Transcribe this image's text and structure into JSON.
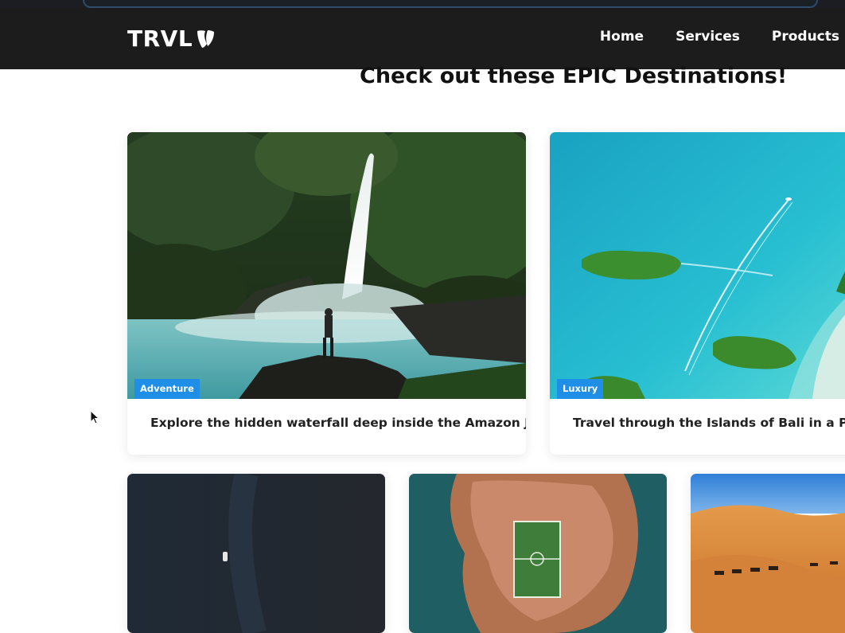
{
  "header": {
    "logo_text": "TRVL",
    "logo_icon": "typo3-icon",
    "nav": [
      {
        "label": "Home"
      },
      {
        "label": "Services"
      },
      {
        "label": "Products"
      }
    ]
  },
  "main": {
    "heading": "Check out these EPIC Destinations!",
    "cards": [
      {
        "image": "waterfall-jungle-photo",
        "badge": "Adventure",
        "title": "Explore the hidden waterfall deep inside the Amazon Jungle"
      },
      {
        "image": "bali-islands-aerial-photo",
        "badge": "Luxury",
        "title": "Travel through the Islands of Bali in a Private C"
      },
      {
        "image": "ocean-boat-aerial-photo"
      },
      {
        "image": "island-football-field-photo"
      },
      {
        "image": "desert-camels-photo"
      }
    ]
  },
  "colors": {
    "navbar_bg": "#1c1c1d",
    "badge_bg": "#1e8ee6",
    "page_bg": "#ffffff"
  }
}
